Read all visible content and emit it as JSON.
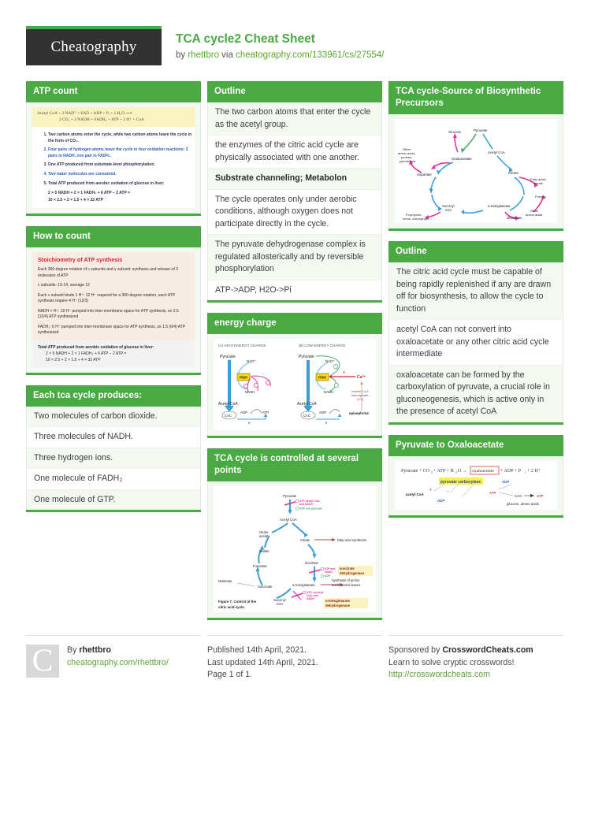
{
  "header": {
    "logo_text": "Cheatography",
    "title": "TCA cycle2 Cheat Sheet",
    "by_prefix": "by ",
    "author": "rhettbro",
    "via": " via ",
    "source_link": "cheatography.com/133961/cs/27554/"
  },
  "colors": {
    "green": "#49a942",
    "link_green": "#5aa832",
    "dark": "#333232",
    "red": "#e0202a",
    "highlight_yellow": "#fbf3bf"
  },
  "columns": [
    {
      "cards": [
        {
          "title": "ATP count",
          "type": "figure",
          "figure": {
            "name": "atp-count-figure",
            "equation_line1": "Acetyl CoA + 3 NAD⁺ + FAD + ADP + Pᵢ + 2 H₂O ⟶",
            "equation_line2": "2 CO₂ + 3 NADH + FADH₂ + ATP + 2 H⁺ + CoA",
            "items": [
              {
                "text": "Two carbon atoms enter the cycle, while two carbon atoms leave the cycle in the form of CO₂.",
                "color": "dark"
              },
              {
                "text": "Four pairs of hydrogen atoms leave the cycle in four oxidation reactions: 3 pairs in NADH, one pair in FADH₂.",
                "color": "blue"
              },
              {
                "text": "One ATP produced from substrate-level phosphorylation.",
                "color": "dark"
              },
              {
                "text": "Two water molecules are consumed.",
                "color": "blue"
              },
              {
                "text": "Total ATP produced from aerobic oxidation of glucose in liver:",
                "color": "dark",
                "tail_green": "in liver:"
              }
            ],
            "sub_equations": [
              "2 × 5 NADH + 2 × 1 FADH₂ + 6 ATP − 2 ATP =",
              "10 × 2.5 + 2 × 1.5 + 4 = 32 ATP"
            ]
          }
        },
        {
          "title": "How to count",
          "type": "figure",
          "figure": {
            "name": "stoichiometry-of-atp-synthesis-figure",
            "heading": "Stoichiometry of ATP synthesis",
            "paragraphs": [
              "Each 360-degree rotation of c subunits and γ subunit: synthesis and release of 3 molecules of ATP",
              "c subunits: 10-14, average 12",
              "Each c subunit binds 1 H⁺: 12 H⁺ required for a 360-degree rotation, each ATP synthesis require 4 H⁺ (12/3)",
              "NADH + H⁺: 10 H⁺ pumped into inter-membrane space for ATP synthesis, so 2.5 (10/4) ATP synthesized",
              "FADH₂: 6 H⁺ pumped into inter-membrane space for ATP synthesis, so 1.5 (6/4) ATP synthesized"
            ],
            "total_title": "Total ATP produced from aerobic oxidation of glucose in liver:",
            "total_lines": [
              "2 × 5 NADH + 2 × 1 FADH₂ + 6 ATP − 2 ATP =",
              "10 × 2.5 + 2 × 1.5 + 4 = 32 ATP"
            ]
          }
        },
        {
          "title": "Each tca cycle produces:",
          "type": "rows",
          "rows": [
            {
              "text": "Two molecules of carbon dioxide.",
              "bold": false
            },
            {
              "text": "Three molecules of NADH.",
              "bold": false
            },
            {
              "text": "Three hydrogen ions.",
              "bold": false
            },
            {
              "text": "One molecule of FADH₂",
              "bold": false
            },
            {
              "text": "One molecule of GTP.",
              "bold": false
            }
          ]
        }
      ]
    },
    {
      "cards": [
        {
          "title": "Outline",
          "type": "rows",
          "rows": [
            {
              "text": "The two carbon atoms that enter the cycle as the acetyl group.",
              "bold": false
            },
            {
              "text": "the enzymes of the citric acid cycle are physically associated with one another.",
              "bold": false
            },
            {
              "text": "Substrate channeling; Metabolon",
              "bold": true
            },
            {
              "text": "The cycle operates only under aerobic conditions, although oxygen does not participate directly in the cycle.",
              "bold": false
            },
            {
              "text": "The pyruvate dehydrogenase complex is regulated allosterically and by reversible phosphorylation",
              "bold": false
            },
            {
              "text": "ATP->ADP, H2O->Pi",
              "bold": false
            }
          ]
        },
        {
          "title": "energy charge",
          "type": "figure",
          "figure": {
            "name": "energy-charge-figure",
            "panel_a_label": "(A) HIGH ENERGY CHARGE",
            "panel_b_label": "(B) LOW ENERGY CHARGE",
            "labels": [
              "Pyruvate",
              "NAD⁺",
              "PDH",
              "NADH",
              "Acetyl CoA",
              "CAC",
              "ADP",
              "ATP",
              "e⁻",
              "Ca²⁺",
              "inositol 1,4,5-triphosphate, (IP3)",
              "epinephrine"
            ]
          }
        },
        {
          "title": "TCA cycle is controlled at several points",
          "type": "figure",
          "figure": {
            "name": "tca-control-points-figure",
            "caption": "Figure 7. Control of the citric acid cycle.",
            "labels": [
              "Pyruvate",
              "Acetyl CoA",
              "Oxalo-acetate",
              "Citrate",
              "Isocitrate",
              "α-Ketoglutarate",
              "Succinyl CoA",
              "Succinate",
              "Fumarate",
              "Malate",
              "Malonate"
            ],
            "annotations": [
              "ATP, acetyl CoA, and NADH",
              "ADP and pyruvate",
              "ATP and NADH",
              "ADP",
              "ATP, succinyl CoA, and NADH",
              "fatty acid synthesis",
              "Synthesis of amino acids, purine bases"
            ],
            "enzyme_boxes": [
              "isocitrate dehydrogenase",
              "α-Ketoglutarate dehydrogenase"
            ]
          }
        }
      ]
    },
    {
      "cards": [
        {
          "title": "TCA cycle-Source of Biosynthetic Precursors",
          "type": "figure",
          "figure": {
            "name": "biosynthetic-precursors-figure",
            "labels": [
              "Glucose",
              "Pyruvate",
              "Acetyl CoA",
              "Oxaloacetate",
              "Citrate",
              "Aspartate",
              "Other amino acids, purines, pyrimidines",
              "Fatty acids, sterols",
              "Succinyl CoA",
              "α-Ketoglutarate",
              "Glutamate",
              "Purines",
              "Other amino acids",
              "Porphyrins, heme, chlorophyll"
            ]
          }
        },
        {
          "title": "Outline",
          "type": "rows",
          "rows": [
            {
              "text": "The citric acid cycle must be capable of being rapidly replenished if any are drawn off for biosynthesis, to allow the cycle to function",
              "bold": false
            },
            {
              "text": "acetyl CoA can not convert into oxaloacetate or any other citric acid cycle intermediate",
              "bold": false
            },
            {
              "text": "oxaloacetate can be formed by the carboxylation of pyruvate, a crucial role in gluconeogenesis, which is active only in the presence of acetyl CoA",
              "bold": false
            }
          ]
        },
        {
          "title": "Pyruvate to Oxaloacetate",
          "type": "figure",
          "figure": {
            "name": "pyruvate-to-oxaloacetate-figure",
            "equation": "Pyruvate + CO₂ + ATP + H₂O → oxaloacetate + ADP + Pᵢ + 2 H⁺",
            "enzyme": "pyruvate carboxylase",
            "labels": [
              "acetyl CoA",
              "ADP",
              "ATP",
              "ADP",
              "CAC",
              "ATP",
              "glucose, amino acids"
            ]
          }
        }
      ]
    }
  ],
  "footer": {
    "left": {
      "avatar_letter": "C",
      "by_label": "By ",
      "author": "rhettbro",
      "profile_link": "cheatography.com/rhettbro/"
    },
    "middle": {
      "published": "Published 14th April, 2021.",
      "updated": "Last updated 14th April, 2021.",
      "page": "Page 1 of 1."
    },
    "right": {
      "sponsor_prefix": "Sponsored by ",
      "sponsor_name": "CrosswordCheats.com",
      "tagline": "Learn to solve cryptic crosswords!",
      "link": "http://crosswordcheats.com"
    }
  }
}
